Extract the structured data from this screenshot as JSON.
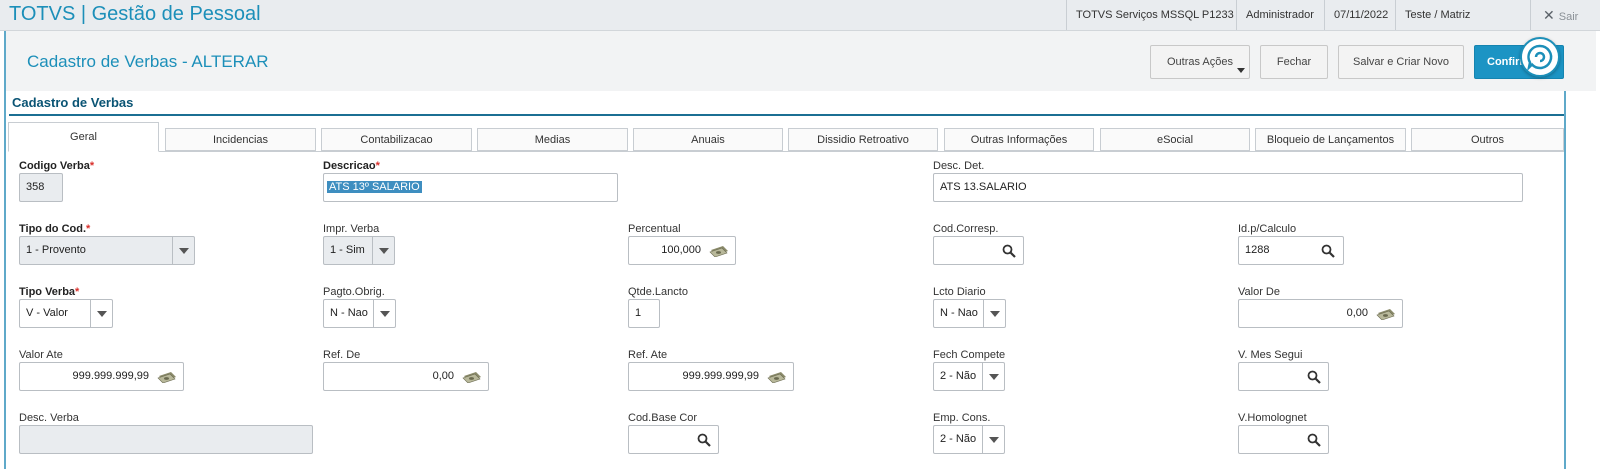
{
  "topbar": {
    "app_title": "TOTVS | Gestão de Pessoal",
    "server": "TOTVS Serviços MSSQL P1233",
    "user": "Administrador",
    "date": "07/11/2022",
    "company": "Teste / Matriz",
    "logout_label": "Sair"
  },
  "header": {
    "page_title": "Cadastro de Verbas - ALTERAR",
    "more_actions_label": "Outras Ações",
    "close_label": "Fechar",
    "save_new_label": "Salvar e Criar Novo",
    "confirm_label": "Confirmar"
  },
  "section": {
    "title": "Cadastro de Verbas"
  },
  "tabs": [
    {
      "label": "Geral"
    },
    {
      "label": "Incidencias"
    },
    {
      "label": "Contabilizacao"
    },
    {
      "label": "Medias"
    },
    {
      "label": "Anuais"
    },
    {
      "label": "Dissidio Retroativo"
    },
    {
      "label": "Outras Informações"
    },
    {
      "label": "eSocial"
    },
    {
      "label": "Bloqueio de Lançamentos"
    },
    {
      "label": "Outros"
    }
  ],
  "form": {
    "codigo_verba": {
      "label": "Codigo Verba",
      "value": "358"
    },
    "descricao": {
      "label": "Descricao",
      "value": "ATS 13º SALARIO"
    },
    "desc_det": {
      "label": "Desc. Det.",
      "value": "ATS 13.SALARIO"
    },
    "tipo_cod": {
      "label": "Tipo do Cod.",
      "value": "1 - Provento"
    },
    "impr_verba": {
      "label": "Impr. Verba",
      "value": "1 - Sim"
    },
    "percentual": {
      "label": "Percentual",
      "value": "100,000"
    },
    "cod_corresp": {
      "label": "Cod.Corresp.",
      "value": ""
    },
    "id_calculo": {
      "label": "Id.p/Calculo",
      "value": "1288"
    },
    "tipo_verba": {
      "label": "Tipo Verba",
      "value": "V - Valor"
    },
    "pagto_obrig": {
      "label": "Pagto.Obrig.",
      "value": "N - Nao"
    },
    "qtde_lancto": {
      "label": "Qtde.Lancto",
      "value": "1"
    },
    "lcto_diario": {
      "label": "Lcto Diario",
      "value": "N - Nao"
    },
    "valor_de": {
      "label": "Valor De",
      "value": "0,00"
    },
    "valor_ate": {
      "label": "Valor Ate",
      "value": "999.999.999,99"
    },
    "ref_de": {
      "label": "Ref. De",
      "value": "0,00"
    },
    "ref_ate": {
      "label": "Ref. Ate",
      "value": "999.999.999,99"
    },
    "fech_compete": {
      "label": "Fech Compete",
      "value": "2 - Não"
    },
    "v_mes_segui": {
      "label": "V. Mes Segui",
      "value": ""
    },
    "desc_verba": {
      "label": "Desc. Verba",
      "value": ""
    },
    "cod_base_cor": {
      "label": "Cod.Base Cor",
      "value": ""
    },
    "emp_cons": {
      "label": "Emp. Cons.",
      "value": "2 - Não"
    },
    "v_homolognet": {
      "label": "V.Homolognet",
      "value": ""
    }
  },
  "colors": {
    "accent": "#1c8fb9",
    "primary_button": "#1c94c4",
    "section_title": "#0a5474",
    "required": "#d9302c"
  }
}
